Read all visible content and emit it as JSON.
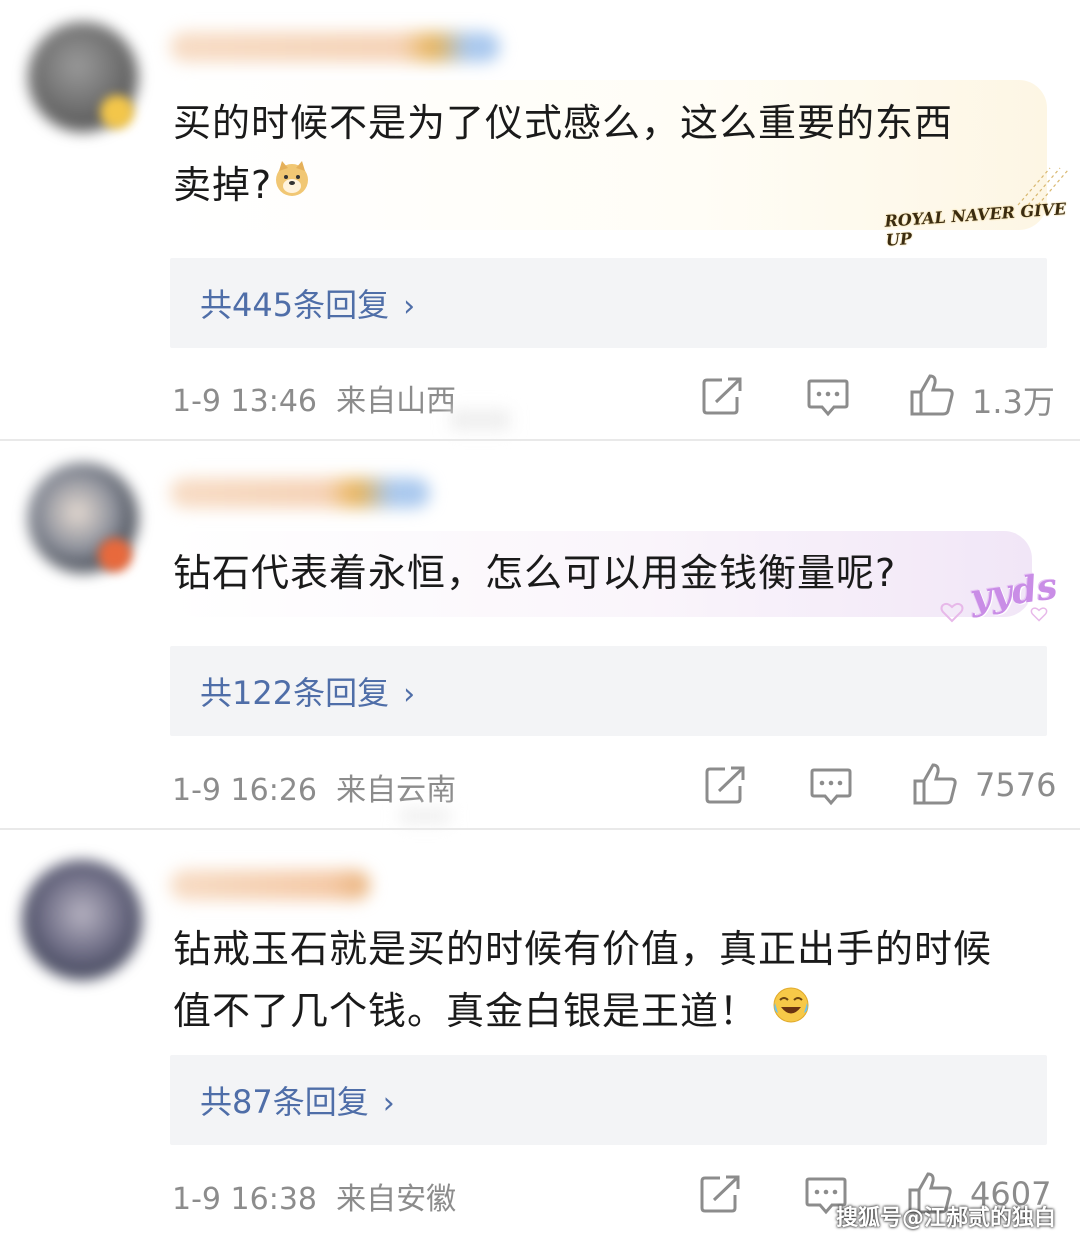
{
  "comments": [
    {
      "text_line1": "买的时候不是为了仪式感么，这么重要的东西",
      "text_line2": "卖掉?",
      "emoji": "doge-emoji",
      "replies_label": "共445条回复",
      "timestamp": "1-9 13:46",
      "location": "来自山西",
      "likes": "1.3万",
      "sticker_text": "ROYAL NAVER GIVE UP"
    },
    {
      "text_line1": "钻石代表着永恒，怎么可以用金钱衡量呢?",
      "replies_label": "共122条回复",
      "timestamp": "1-9 16:26",
      "location": "来自云南",
      "likes": "7576",
      "sticker_text": "yyds"
    },
    {
      "text_line1": "钻戒玉石就是买的时候有价值，真正出手的时候",
      "text_line2": "值不了几个钱。真金白银是王道！",
      "emoji": "laugh-cry-emoji",
      "replies_label": "共87条回复",
      "timestamp": "1-9 16:38",
      "location": "来自安徽",
      "likes": "4607"
    }
  ],
  "watermark": "搜狐号@江郝贰的独白",
  "colors": {
    "link": "#4f6ea8",
    "meta": "#8c8c8c",
    "reply_bg": "#f3f4f6"
  }
}
